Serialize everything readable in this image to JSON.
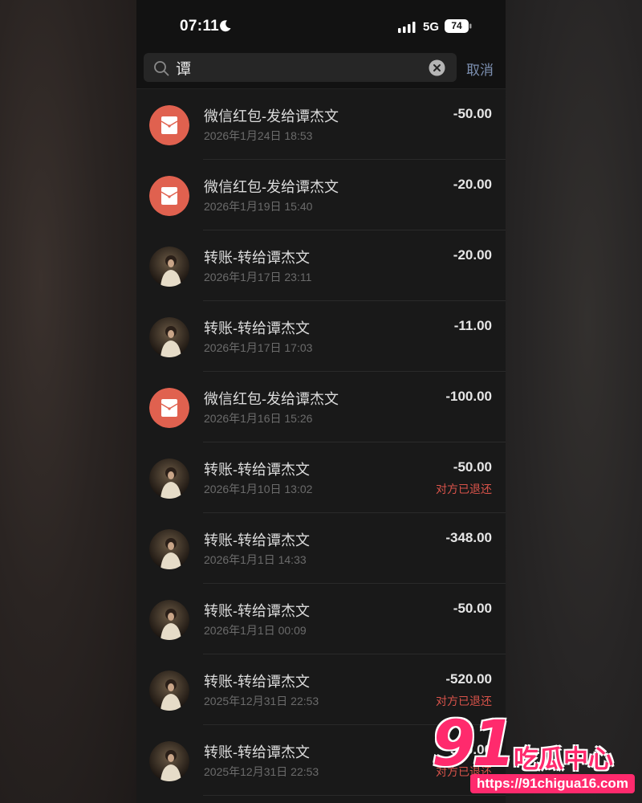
{
  "status_bar": {
    "time": "07:11",
    "network": "5G",
    "battery": "74"
  },
  "search": {
    "query": "谭",
    "placeholder": "",
    "cancel_label": "取消"
  },
  "transactions": [
    {
      "type": "red-packet",
      "title": "微信红包-发给谭杰文",
      "date": "2026年1月24日 18:53",
      "amount": "-50.00",
      "note": ""
    },
    {
      "type": "red-packet",
      "title": "微信红包-发给谭杰文",
      "date": "2026年1月19日 15:40",
      "amount": "-20.00",
      "note": ""
    },
    {
      "type": "transfer",
      "title": "转账-转给谭杰文",
      "date": "2026年1月17日 23:11",
      "amount": "-20.00",
      "note": ""
    },
    {
      "type": "transfer",
      "title": "转账-转给谭杰文",
      "date": "2026年1月17日 17:03",
      "amount": "-11.00",
      "note": ""
    },
    {
      "type": "red-packet",
      "title": "微信红包-发给谭杰文",
      "date": "2026年1月16日 15:26",
      "amount": "-100.00",
      "note": ""
    },
    {
      "type": "transfer",
      "title": "转账-转给谭杰文",
      "date": "2026年1月10日 13:02",
      "amount": "-50.00",
      "note": "对方已退还"
    },
    {
      "type": "transfer",
      "title": "转账-转给谭杰文",
      "date": "2026年1月1日 14:33",
      "amount": "-348.00",
      "note": ""
    },
    {
      "type": "transfer",
      "title": "转账-转给谭杰文",
      "date": "2026年1月1日 00:09",
      "amount": "-50.00",
      "note": ""
    },
    {
      "type": "transfer",
      "title": "转账-转给谭杰文",
      "date": "2025年12月31日 22:53",
      "amount": "-520.00",
      "note": "对方已退还"
    },
    {
      "type": "transfer",
      "title": "转账-转给谭杰文",
      "date": "2025年12月31日 22:53",
      "amount": "-520.00",
      "note": "对方已退还"
    }
  ],
  "watermark": {
    "number": "91",
    "name": "吃瓜中心",
    "url": "https://91chigua16.com"
  },
  "colors": {
    "red_packet": "#e0614f",
    "refund_note": "#d9534a",
    "cancel": "#7c8fb0",
    "watermark": "#ff2a6d"
  },
  "icons": {
    "red_packet": "red-envelope-icon",
    "transfer": "user-avatar",
    "search": "search-icon",
    "clear": "clear-icon"
  }
}
